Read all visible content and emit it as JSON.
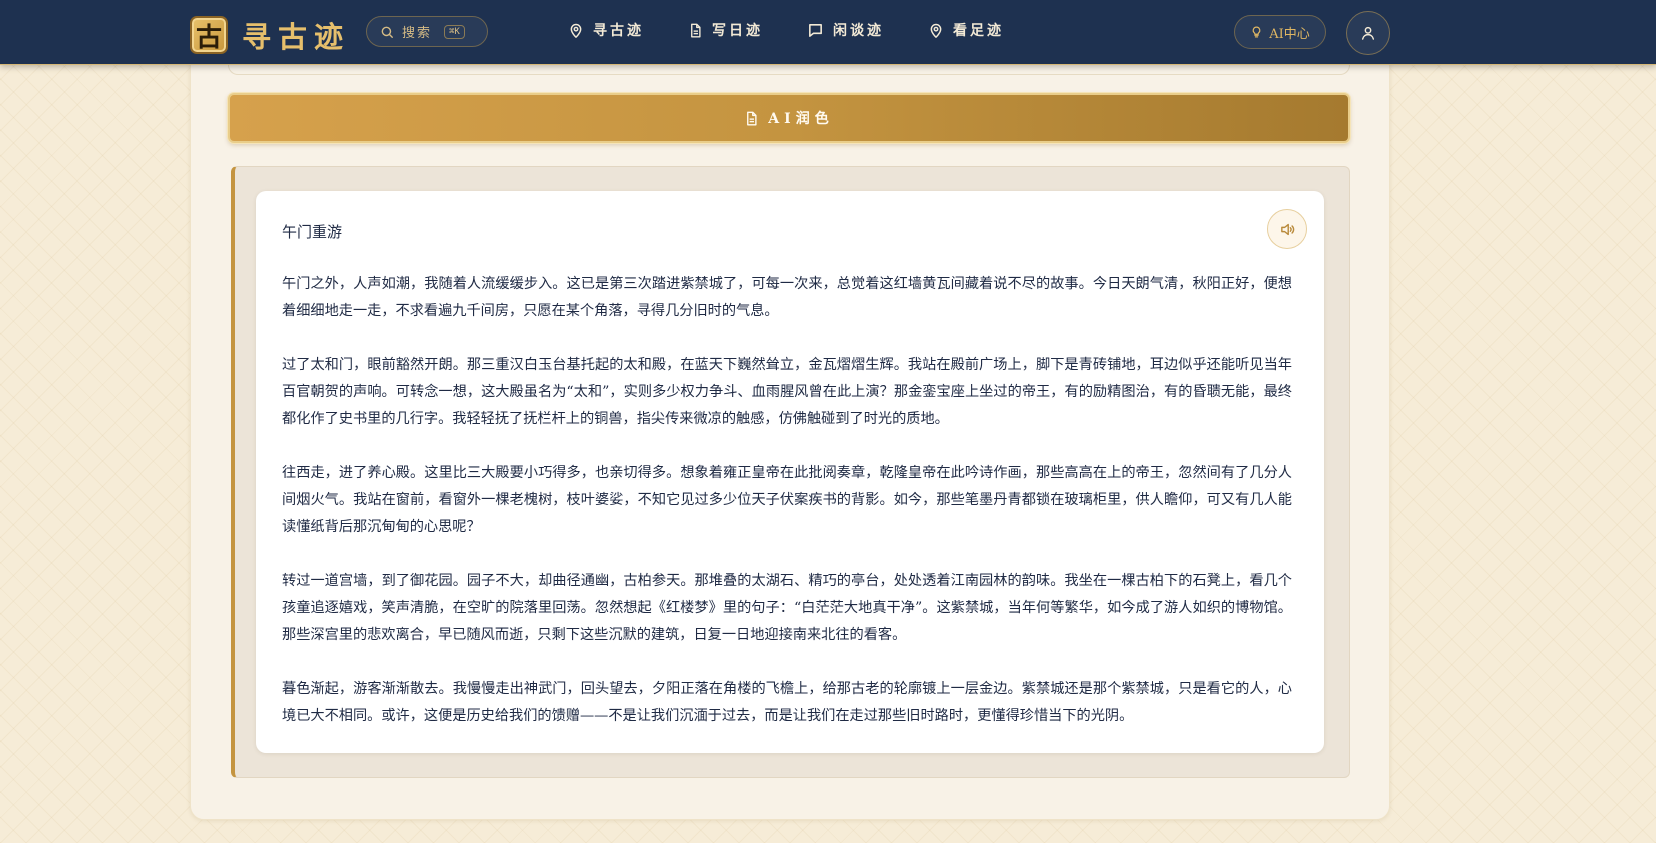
{
  "header": {
    "logo_char": "古",
    "logo_text": "寻古迹",
    "search_label": "搜索",
    "search_shortcut": "⌘K",
    "nav": [
      {
        "label": "寻古迹",
        "icon": "location-pin-icon"
      },
      {
        "label": "写日迹",
        "icon": "document-icon"
      },
      {
        "label": "闲谈迹",
        "icon": "chat-bubble-icon"
      },
      {
        "label": "看足迹",
        "icon": "location-pin-icon"
      }
    ],
    "ai_center_label": "AI中心",
    "user_icon": "user-icon"
  },
  "editor": {
    "polish_button_label": "AI润色"
  },
  "essay": {
    "title": "午门重游",
    "speaker_icon": "speaker-icon",
    "paragraphs": [
      "午门之外，人声如潮，我随着人流缓缓步入。这已是第三次踏进紫禁城了，可每一次来，总觉着这红墙黄瓦间藏着说不尽的故事。今日天朗气清，秋阳正好，便想着细细地走一走，不求看遍九千间房，只愿在某个角落，寻得几分旧时的气息。",
      "过了太和门，眼前豁然开朗。那三重汉白玉台基托起的太和殿，在蓝天下巍然耸立，金瓦熠熠生辉。我站在殿前广场上，脚下是青砖铺地，耳边似乎还能听见当年百官朝贺的声响。可转念一想，这大殿虽名为“太和”，实则多少权力争斗、血雨腥风曾在此上演？那金銮宝座上坐过的帝王，有的励精图治，有的昏聩无能，最终都化作了史书里的几行字。我轻轻抚了抚栏杆上的铜兽，指尖传来微凉的触感，仿佛触碰到了时光的质地。",
      "往西走，进了养心殿。这里比三大殿要小巧得多，也亲切得多。想象着雍正皇帝在此批阅奏章，乾隆皇帝在此吟诗作画，那些高高在上的帝王，忽然间有了几分人间烟火气。我站在窗前，看窗外一棵老槐树，枝叶婆娑，不知它见过多少位天子伏案疾书的背影。如今，那些笔墨丹青都锁在玻璃柜里，供人瞻仰，可又有几人能读懂纸背后那沉甸甸的心思呢？",
      "转过一道宫墙，到了御花园。园子不大，却曲径通幽，古柏参天。那堆叠的太湖石、精巧的亭台，处处透着江南园林的韵味。我坐在一棵古柏下的石凳上，看几个孩童追逐嬉戏，笑声清脆，在空旷的院落里回荡。忽然想起《红楼梦》里的句子：“白茫茫大地真干净”。这紫禁城，当年何等繁华，如今成了游人如织的博物馆。那些深宫里的悲欢离合，早已随风而逝，只剩下这些沉默的建筑，日复一日地迎接南来北往的看客。",
      "暮色渐起，游客渐渐散去。我慢慢走出神武门，回头望去，夕阳正落在角楼的飞檐上，给那古老的轮廓镀上一层金边。紫禁城还是那个紫禁城，只是看它的人，心境已大不相同。或许，这便是历史给我们的馈赠——不是让我们沉湎于过去，而是让我们在走过那些旧时路时，更懂得珍惜当下的光阴。"
    ]
  },
  "colors": {
    "navbar_bg": "#1e3150",
    "gold_accent": "#c49440",
    "text_primary": "#1f2a44"
  }
}
